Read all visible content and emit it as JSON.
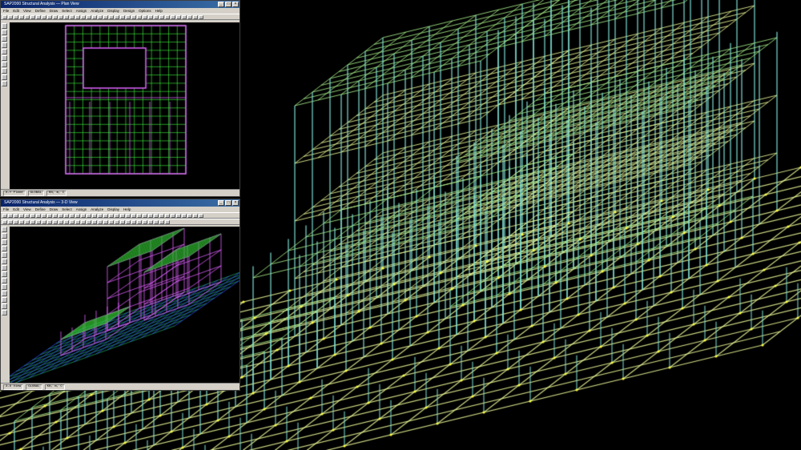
{
  "window_plan": {
    "title": "SAP2000 Structural Analysis — Plan View",
    "menu": [
      "File",
      "Edit",
      "View",
      "Define",
      "Draw",
      "Select",
      "Assign",
      "Analyze",
      "Display",
      "Design",
      "Options",
      "Help"
    ],
    "status": [
      "X-Y Plane",
      "GLOBAL",
      "KN, m, C"
    ]
  },
  "window_3d": {
    "title": "SAP2000 Structural Analysis — 3-D View",
    "menu": [
      "File",
      "Edit",
      "View",
      "Define",
      "Draw",
      "Select",
      "Assign",
      "Analyze",
      "Display",
      "Help"
    ],
    "status": [
      "3-D View",
      "GLOBAL",
      "KN, m, C"
    ]
  },
  "colors": {
    "column": "#7fe0d6",
    "beam": "#f2ff9a",
    "roof": "#a8f08a",
    "node": "#ffff40",
    "plan_wall": "#e060ff",
    "plan_grid": "#40ff40"
  }
}
